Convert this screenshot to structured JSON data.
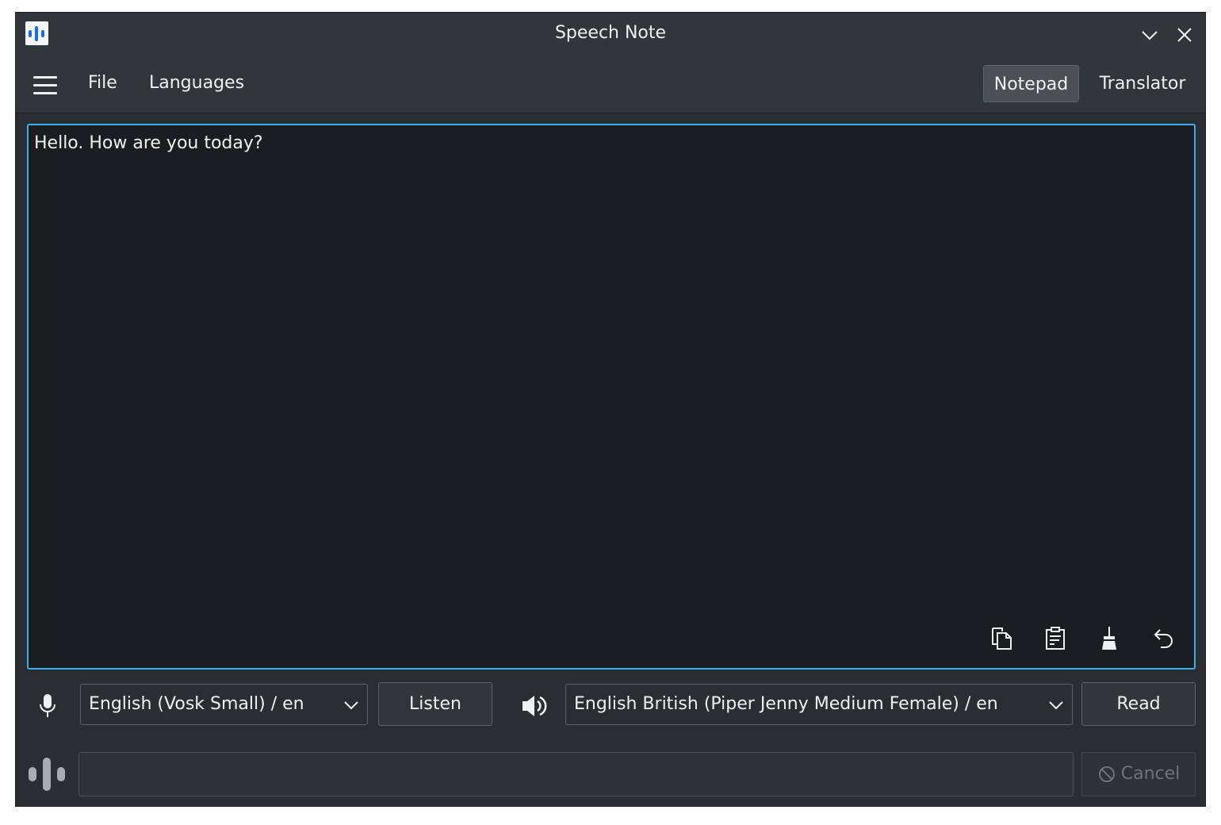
{
  "window": {
    "title": "Speech Note"
  },
  "menubar": {
    "file_label": "File",
    "languages_label": "Languages",
    "modes": [
      {
        "label": "Notepad",
        "active": true
      },
      {
        "label": "Translator",
        "active": false
      }
    ]
  },
  "editor": {
    "text": "Hello. How are you today?"
  },
  "stt": {
    "model_selected": "English (Vosk Small) / en",
    "listen_label": "Listen"
  },
  "tts": {
    "voice_selected": "English British (Piper Jenny Medium Female) / en",
    "read_label": "Read"
  },
  "status": {
    "text": "",
    "cancel_label": "Cancel"
  },
  "colors": {
    "accent": "#3daee9",
    "background": "#2a2e32",
    "editor_bg": "#1b1e20"
  }
}
